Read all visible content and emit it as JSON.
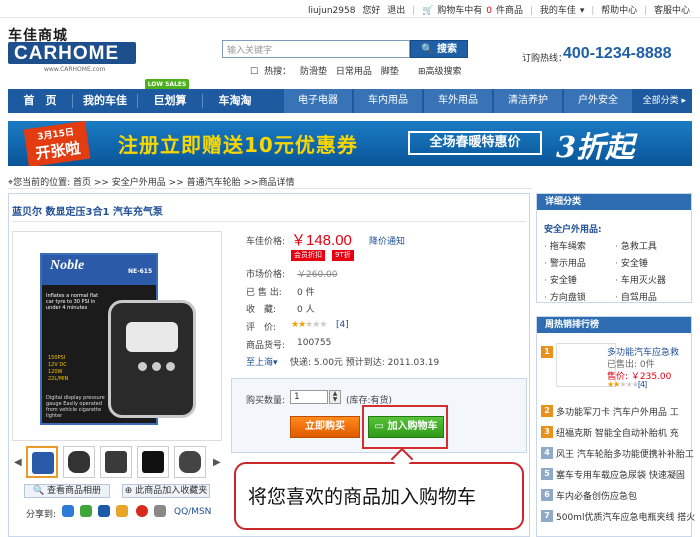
{
  "topbar": {
    "username": "liujun2958",
    "greeting": "您好",
    "logout": "退出",
    "cart_prefix": "购物车中有",
    "cart_count": "0",
    "cart_suffix": "件商品",
    "my_car": "我的车佳",
    "help": "帮助中心",
    "service": "客服中心"
  },
  "header": {
    "logo_cn": "车佳商城",
    "logo_en": "CARHOME",
    "logo_url": "www.CARHOME.com",
    "search_placeholder": "输入关键字",
    "search_button": "搜索",
    "hot_label": "热搜：",
    "hot_words": [
      "防滑垫",
      "日常用品",
      "脚垫"
    ],
    "advanced_search": "高级搜索",
    "hotline_label": "订购热线：",
    "hotline": "400-1234-8888"
  },
  "nav": {
    "main": [
      "首　页",
      "我的车佳",
      "巨划算",
      "车淘淘"
    ],
    "badge": "LOW SALES",
    "sub": [
      "电子电器",
      "车内用品",
      "车外用品",
      "清洁养护",
      "户外安全"
    ],
    "all": "全部分类"
  },
  "banner": {
    "date": "3月15日",
    "tag": "开张啦",
    "main": "注册立即赠送10元优惠券",
    "box": "全场春暖特惠价",
    "big": "3折起"
  },
  "breadcrumb": "您当前的位置: 首页 >> 安全户外用品 >> 普通汽车轮胎 >>商品详情",
  "product": {
    "title": "蓝贝尔 数显定压3合1 汽车充气泵",
    "box_brand": "Noble",
    "box_model": "NE-615",
    "box_desc": "Inflates a normal flat car tyre to 30 PSI in under 4 minutes",
    "box_specs": [
      "150PSI",
      "12V DC",
      "120W",
      "22L/MIN"
    ],
    "box_foot": "Digital display pressure gauge Easily operated from vehicle cigarette lighter",
    "price_label": "车佳价格:",
    "price": "￥148.00",
    "price_notice": "降价通知",
    "tags": [
      "会员折扣",
      "9T折"
    ],
    "market_label": "市场价格:",
    "market_price": "￥260.00",
    "sold_label": "已 售 出:",
    "sold": "0 件",
    "fav_label": "收　藏:",
    "fav": "0 人",
    "rating_label": "评　价:",
    "rating": 2,
    "rating_max": 5,
    "review_count": "[4]",
    "code_label": "商品货号:",
    "code": "100755",
    "ship_to": "至上海",
    "ship_info": "快递: 5.00元  预计到达: 2011.03.19",
    "qty_label": "购买数量:",
    "qty": "1",
    "stock": "(库存:有货)",
    "buy_now": "立即购买",
    "add_cart": "加入购物车",
    "gallery": "查看商品相册",
    "favorite": "此商品加入收藏夹",
    "share_label": "分享到:",
    "share_qq": "QQ/MSN"
  },
  "callout": "将您喜欢的商品加入购物车",
  "sidebar": {
    "detail_head": "详细分类",
    "cat_title": "安全户外用品:",
    "categories": [
      "拖车绳索",
      "急救工具",
      "警示用品",
      "安全锤",
      "安全锤",
      "车用灭火器",
      "方向盘锁",
      "自驾用品"
    ],
    "rank_head": "周热销排行榜",
    "rank1_name": "多功能汽车应急救",
    "rank1_sold": "已售出: 0件",
    "rank1_price": "售价: ￥235.00",
    "rank1_reviews": "[4]",
    "ranks": [
      "多功能军刀卡 汽车户外用品 工",
      "纽福克斯 智能全自动补胎机 充",
      "风王 汽车轮胎多功能便携补补胎工",
      "塞车专用车载应急尿袋 快速凝固",
      "车内必备创伤应急包",
      "500ml优质汽车应急电瓶夹线 搭火"
    ]
  }
}
